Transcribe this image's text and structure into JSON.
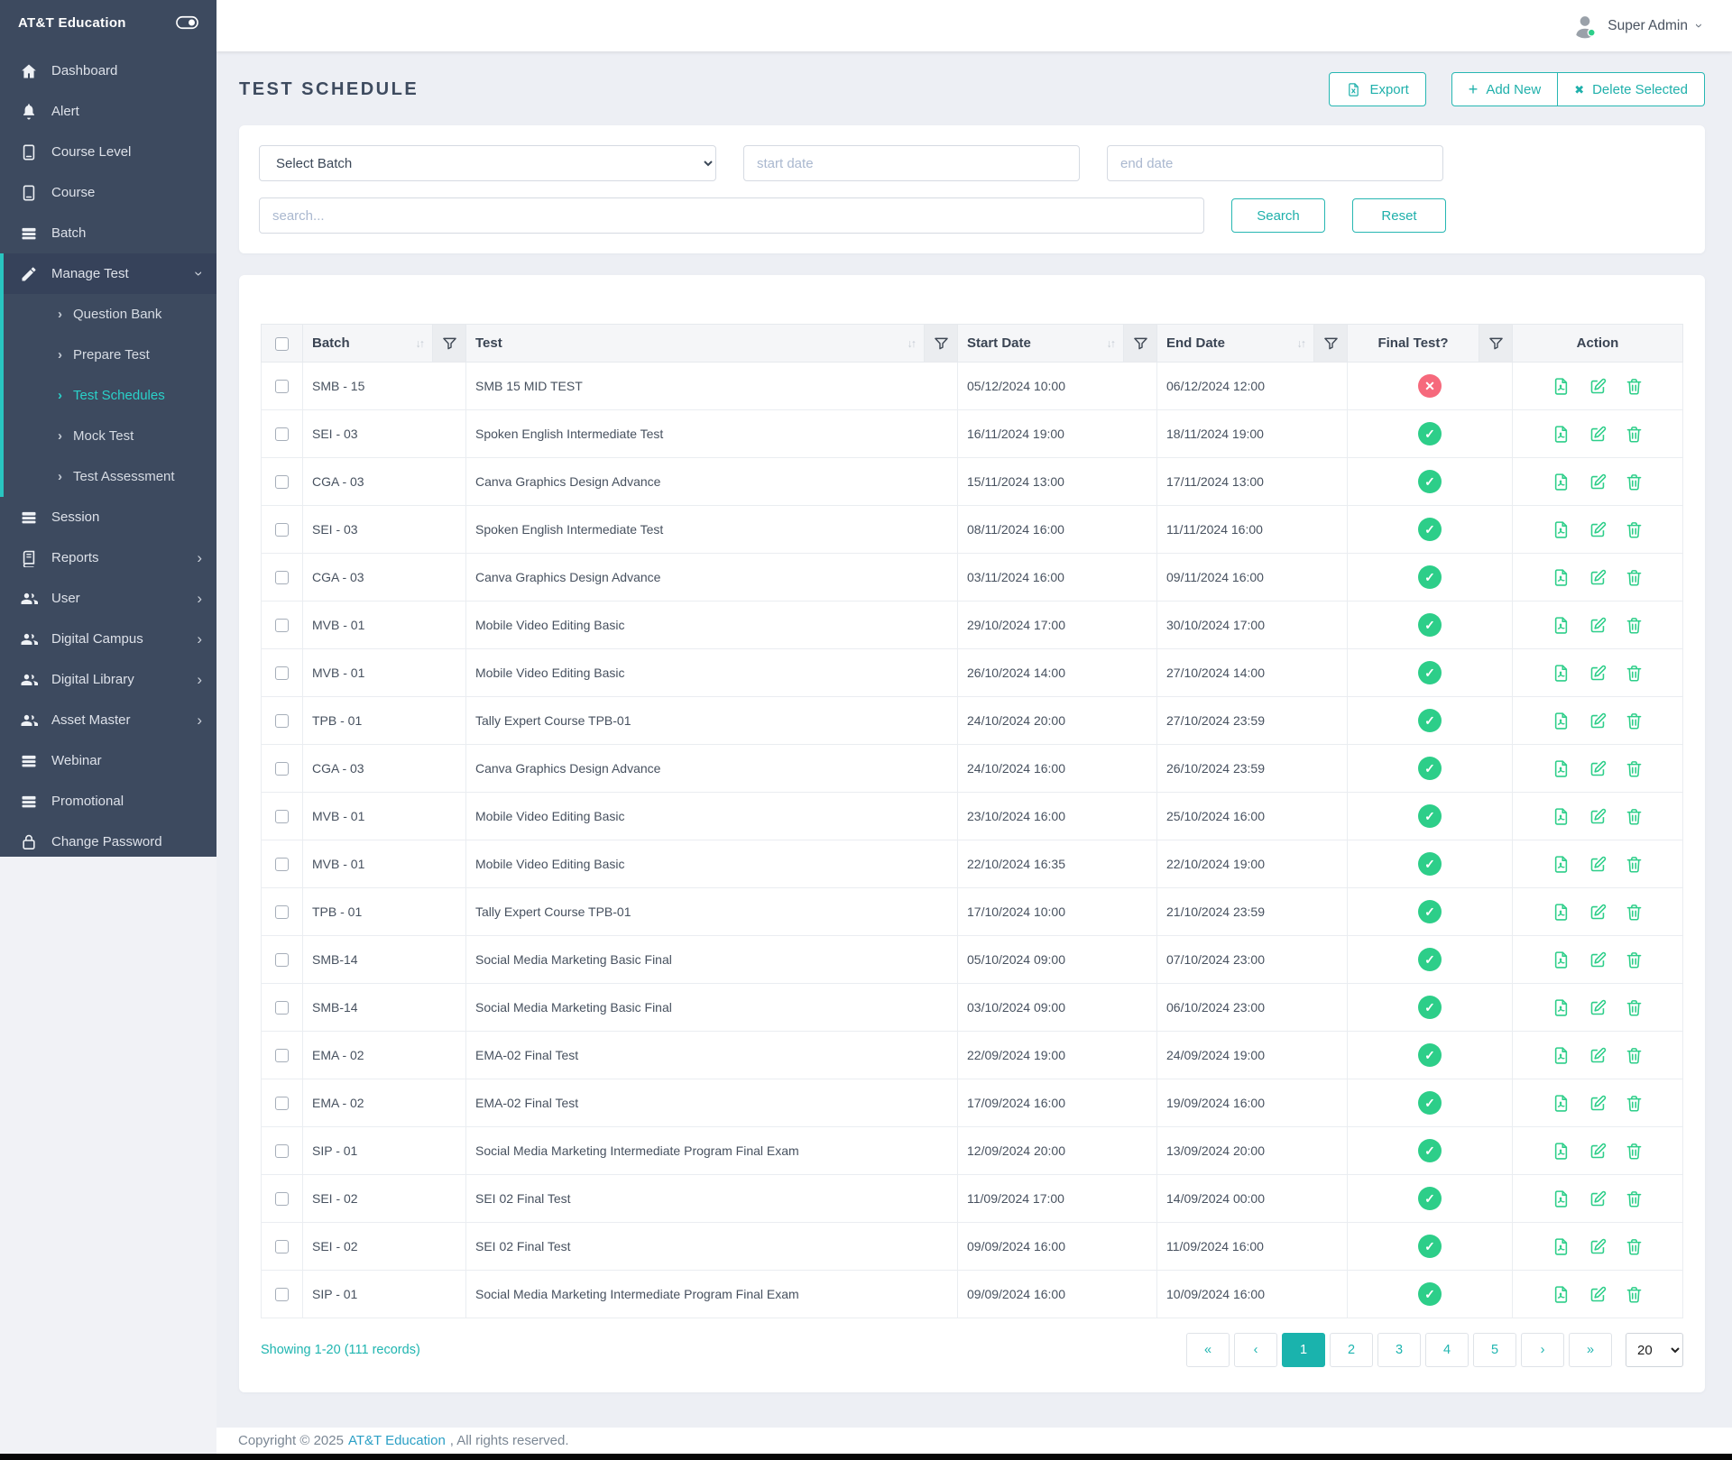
{
  "sidebar": {
    "brand": "AT&T Education",
    "toggle_icon": "sidebar-toggle-icon",
    "items": [
      {
        "label": "Dashboard",
        "icon": "home-icon"
      },
      {
        "label": "Alert",
        "icon": "bell-icon"
      },
      {
        "label": "Course Level",
        "icon": "book-icon"
      },
      {
        "label": "Course",
        "icon": "book-icon"
      },
      {
        "label": "Batch",
        "icon": "stack-icon"
      },
      {
        "label": "Manage Test",
        "icon": "pencil-icon",
        "state": "expanded-active"
      },
      {
        "label": "Session",
        "icon": "stack-icon"
      },
      {
        "label": "Reports",
        "icon": "report-book-icon",
        "expandable": true
      },
      {
        "label": "User",
        "icon": "users-icon",
        "expandable": true
      },
      {
        "label": "Digital Campus",
        "icon": "users-icon",
        "expandable": true
      },
      {
        "label": "Digital Library",
        "icon": "users-icon",
        "expandable": true
      },
      {
        "label": "Asset Master",
        "icon": "users-icon",
        "expandable": true
      },
      {
        "label": "Webinar",
        "icon": "stack-icon"
      },
      {
        "label": "Promotional",
        "icon": "stack-icon"
      },
      {
        "label": "Change Password",
        "icon": "lock-icon"
      }
    ],
    "submenu": [
      {
        "label": "Question Bank",
        "active": false
      },
      {
        "label": "Prepare Test",
        "active": false
      },
      {
        "label": "Test Schedules",
        "active": true
      },
      {
        "label": "Mock Test",
        "active": false
      },
      {
        "label": "Test Assessment",
        "active": false
      }
    ]
  },
  "topbar": {
    "user_name": "Super Admin",
    "avatar_icon": "user-avatar-icon",
    "status_color": "#2dce89"
  },
  "page": {
    "title": "TEST SCHEDULE",
    "actions": {
      "export": "Export",
      "add_new": "Add New",
      "delete_selected": "Delete Selected"
    },
    "filters": {
      "select_batch": "Select Batch",
      "start_date_placeholder": "start date",
      "end_date_placeholder": "end date",
      "search_placeholder": "search...",
      "search_button": "Search",
      "reset_button": "Reset"
    },
    "accent_teal": "#1fb5b0",
    "success_green": "#2dce89",
    "danger_red": "#f6697c"
  },
  "table": {
    "headers": {
      "batch": "Batch",
      "test": "Test",
      "start_date": "Start Date",
      "end_date": "End Date",
      "final_test": "Final Test?",
      "action": "Action"
    },
    "action_icons": [
      "pdf-file-icon",
      "edit-icon",
      "trash-icon"
    ],
    "rows": [
      {
        "batch": "SMB - 15",
        "test": "SMB 15 MID TEST",
        "start": "05/12/2024 10:00",
        "end": "06/12/2024 12:00",
        "final": "no"
      },
      {
        "batch": "SEI - 03",
        "test": "Spoken English Intermediate Test",
        "start": "16/11/2024 19:00",
        "end": "18/11/2024 19:00",
        "final": "yes"
      },
      {
        "batch": "CGA - 03",
        "test": "Canva Graphics Design Advance",
        "start": "15/11/2024 13:00",
        "end": "17/11/2024 13:00",
        "final": "yes"
      },
      {
        "batch": "SEI - 03",
        "test": "Spoken English Intermediate Test",
        "start": "08/11/2024 16:00",
        "end": "11/11/2024 16:00",
        "final": "yes"
      },
      {
        "batch": "CGA - 03",
        "test": "Canva Graphics Design Advance",
        "start": "03/11/2024 16:00",
        "end": "09/11/2024 16:00",
        "final": "yes"
      },
      {
        "batch": "MVB - 01",
        "test": "Mobile Video Editing Basic",
        "start": "29/10/2024 17:00",
        "end": "30/10/2024 17:00",
        "final": "yes"
      },
      {
        "batch": "MVB - 01",
        "test": "Mobile Video Editing Basic",
        "start": "26/10/2024 14:00",
        "end": "27/10/2024 14:00",
        "final": "yes"
      },
      {
        "batch": "TPB - 01",
        "test": "Tally Expert Course TPB-01",
        "start": "24/10/2024 20:00",
        "end": "27/10/2024 23:59",
        "final": "yes"
      },
      {
        "batch": "CGA - 03",
        "test": "Canva Graphics Design Advance",
        "start": "24/10/2024 16:00",
        "end": "26/10/2024 23:59",
        "final": "yes"
      },
      {
        "batch": "MVB - 01",
        "test": "Mobile Video Editing Basic",
        "start": "23/10/2024 16:00",
        "end": "25/10/2024 16:00",
        "final": "yes"
      },
      {
        "batch": "MVB - 01",
        "test": "Mobile Video Editing Basic",
        "start": "22/10/2024 16:35",
        "end": "22/10/2024 19:00",
        "final": "yes"
      },
      {
        "batch": "TPB - 01",
        "test": "Tally Expert Course TPB-01",
        "start": "17/10/2024 10:00",
        "end": "21/10/2024 23:59",
        "final": "yes"
      },
      {
        "batch": "SMB-14",
        "test": "Social Media Marketing Basic Final",
        "start": "05/10/2024 09:00",
        "end": "07/10/2024 23:00",
        "final": "yes"
      },
      {
        "batch": "SMB-14",
        "test": "Social Media Marketing Basic Final",
        "start": "03/10/2024 09:00",
        "end": "06/10/2024 23:00",
        "final": "yes"
      },
      {
        "batch": "EMA - 02",
        "test": "EMA-02 Final Test",
        "start": "22/09/2024 19:00",
        "end": "24/09/2024 19:00",
        "final": "yes"
      },
      {
        "batch": "EMA - 02",
        "test": "EMA-02 Final Test",
        "start": "17/09/2024 16:00",
        "end": "19/09/2024 16:00",
        "final": "yes"
      },
      {
        "batch": "SIP - 01",
        "test": "Social Media Marketing Intermediate Program Final Exam",
        "start": "12/09/2024 20:00",
        "end": "13/09/2024 20:00",
        "final": "yes"
      },
      {
        "batch": "SEI - 02",
        "test": "SEI 02 Final Test",
        "start": "11/09/2024 17:00",
        "end": "14/09/2024 00:00",
        "final": "yes"
      },
      {
        "batch": "SEI - 02",
        "test": "SEI 02 Final Test",
        "start": "09/09/2024 16:00",
        "end": "11/09/2024 16:00",
        "final": "yes"
      },
      {
        "batch": "SIP - 01",
        "test": "Social Media Marketing Intermediate Program Final Exam",
        "start": "09/09/2024 16:00",
        "end": "10/09/2024 16:00",
        "final": "yes"
      }
    ]
  },
  "pagination": {
    "summary": "Showing 1-20 (111 records)",
    "pages": [
      {
        "label": "«",
        "active": false
      },
      {
        "label": "‹",
        "active": false
      },
      {
        "label": "1",
        "active": true
      },
      {
        "label": "2",
        "active": false
      },
      {
        "label": "3",
        "active": false
      },
      {
        "label": "4",
        "active": false
      },
      {
        "label": "5",
        "active": false
      },
      {
        "label": "›",
        "active": false
      },
      {
        "label": "»",
        "active": false
      }
    ],
    "page_size": "20"
  },
  "footer": {
    "prefix": "Copyright © 2025",
    "brand_link": "AT&T Education",
    "suffix": ", All rights reserved."
  }
}
